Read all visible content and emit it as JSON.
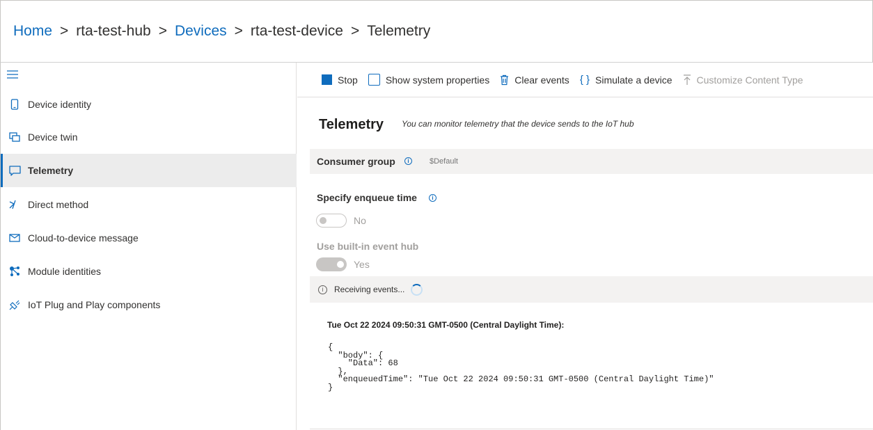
{
  "breadcrumb": {
    "home": "Home",
    "sep": ">",
    "hub": "rta-test-hub",
    "devices": "Devices",
    "device": "rta-test-device",
    "current": "Telemetry"
  },
  "sidebar": {
    "items": [
      {
        "label": "Device identity",
        "icon": "phone-icon"
      },
      {
        "label": "Device twin",
        "icon": "twin-icon"
      },
      {
        "label": "Telemetry",
        "icon": "chat-icon"
      },
      {
        "label": "Direct method",
        "icon": "method-icon"
      },
      {
        "label": "Cloud-to-device message",
        "icon": "mail-icon"
      },
      {
        "label": "Module identities",
        "icon": "modules-icon"
      },
      {
        "label": "IoT Plug and Play components",
        "icon": "plug-icon"
      }
    ]
  },
  "toolbar": {
    "stop": "Stop",
    "show_system_properties": "Show system properties",
    "clear_events": "Clear events",
    "simulate_device": "Simulate a device",
    "customize_content_type": "Customize Content Type"
  },
  "main": {
    "title": "Telemetry",
    "subtitle": "You can monitor telemetry that the device sends to the IoT hub",
    "consumer_group_label": "Consumer group",
    "consumer_group_value": "$Default",
    "enqueue_label": "Specify enqueue time",
    "enqueue_toggle": "No",
    "eventhub_label": "Use built-in event hub",
    "eventhub_toggle": "Yes",
    "status": "Receiving events...",
    "event_time": "Tue Oct 22 2024 09:50:31 GMT-0500 (Central Daylight Time):",
    "event_body": "{\n  \"body\": {\n    \"Data\": 68\n  },\n  \"enqueuedTime\": \"Tue Oct 22 2024 09:50:31 GMT-0500 (Central Daylight Time)\"\n}"
  },
  "colors": {
    "accent": "#0f6cbd",
    "active_bg": "#ececec",
    "panel_bg": "#f3f2f1",
    "disabled": "#a19f9d"
  }
}
